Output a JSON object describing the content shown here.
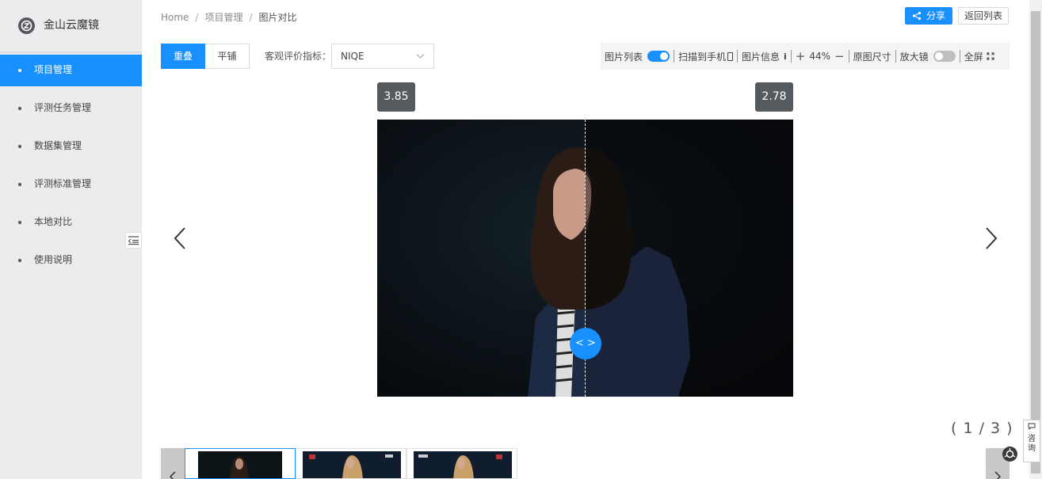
{
  "sidebar": {
    "logo_text": "金山云魔镜",
    "items": [
      {
        "label": "项目管理",
        "active": true
      },
      {
        "label": "评测任务管理",
        "active": false
      },
      {
        "label": "数据集管理",
        "active": false
      },
      {
        "label": "评测标准管理",
        "active": false
      },
      {
        "label": "本地对比",
        "active": false
      },
      {
        "label": "使用说明",
        "active": false
      }
    ]
  },
  "breadcrumb": [
    "Home",
    "项目管理",
    "图片对比"
  ],
  "breadcrumb_sep": "/",
  "header": {
    "share_label": "分享",
    "back_label": "返回列表"
  },
  "mode": {
    "overlay_label": "重叠",
    "tile_label": "平铺",
    "selected": "重叠"
  },
  "metric": {
    "label": "客观评价指标：",
    "value": "NIQE"
  },
  "toolbar": {
    "image_list_label": "图片列表",
    "image_list_on": true,
    "scan_label": "扫描到手机",
    "info_label": "图片信息",
    "info_icon": "i",
    "zoom_plus": "+",
    "zoom_value": "44%",
    "zoom_minus": "−",
    "original_size_label": "原图尺寸",
    "magnifier_label": "放大镜",
    "magnifier_on": false,
    "fullscreen_label": "全屏"
  },
  "scores": {
    "left": "3.85",
    "right": "2.78"
  },
  "split_handle": "< >",
  "pagination": "( 1 / 3 )",
  "consult_label": "咨询",
  "colors": {
    "accent": "#1890ff",
    "sidebar_bg": "#ececee",
    "badge_bg": "#555a5e"
  },
  "icons": {
    "logo": "logo-icon",
    "share": "share-icon",
    "dropdown": "chevron-down-icon",
    "prev": "chevron-left-icon",
    "next": "chevron-right-icon",
    "collapse": "menu-collapse-icon",
    "fullscreen": "expand-icon"
  }
}
